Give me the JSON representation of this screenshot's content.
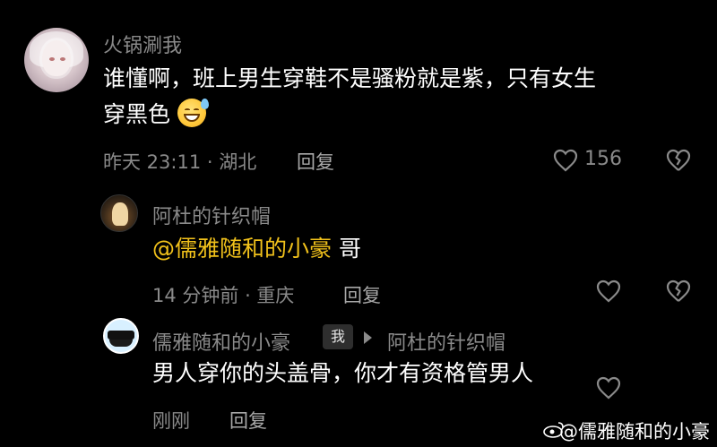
{
  "comments": [
    {
      "username": "火锅涮我",
      "text": "谁懂啊，班上男生穿鞋不是骚粉就是紫，只有女生",
      "text_line2": "穿黑色",
      "emoji": "grinning-sweat-emoji",
      "time": "昨天 23:11 · 湖北",
      "reply_label": "回复",
      "likes": "156"
    },
    {
      "username": "阿杜的针织帽",
      "mention": "@儒雅随和的小豪",
      "text": " 哥",
      "time": "14 分钟前 · 重庆",
      "reply_label": "回复"
    },
    {
      "username": "儒雅随和的小豪",
      "me_tag": "我",
      "reply_to": "阿杜的针织帽",
      "text": "男人穿你的头盖骨，你才有资格管男人",
      "time": "刚刚",
      "reply_label": "回复"
    }
  ],
  "watermark": "@儒雅随和的小豪",
  "colors": {
    "background": "#000000",
    "secondary_text": "#8a8a8a",
    "mention": "#f2c21b"
  }
}
